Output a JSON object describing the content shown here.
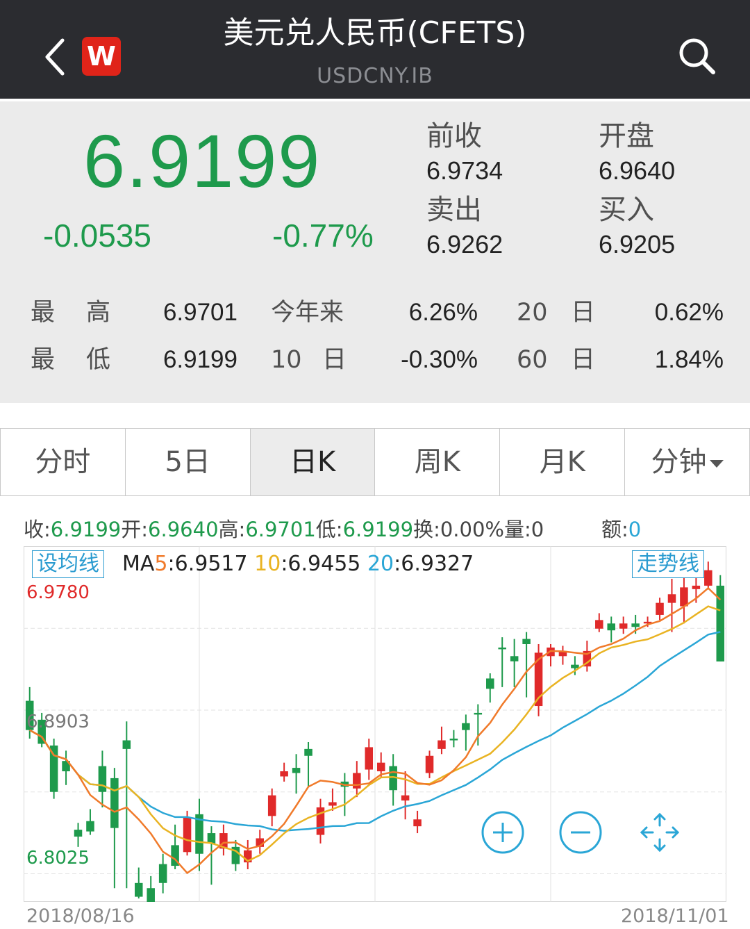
{
  "header": {
    "title": "美元兑人民币(CFETS)",
    "subtitle": "USDCNY.IB",
    "logo_text": "W"
  },
  "quote": {
    "price": "6.9199",
    "change": "-0.0535",
    "change_pct": "-0.77%",
    "prev_close_label": "前收",
    "prev_close": "6.9734",
    "open_label": "开盘",
    "open": "6.9640",
    "sell_label": "卖出",
    "sell": "6.9262",
    "buy_label": "买入",
    "buy": "6.9205",
    "color_down": "#1e9a4c"
  },
  "stats": {
    "high_label1": "最",
    "high_label2": "高",
    "high": "6.9701",
    "low_label1": "最",
    "low_label2": "低",
    "low": "6.9199",
    "ytd_label": "今年来",
    "ytd": "6.26%",
    "d10_num": "10",
    "d10_unit": "日",
    "d10": "-0.30%",
    "d20_num": "20",
    "d20_unit": "日",
    "d20": "0.62%",
    "d60_num": "60",
    "d60_unit": "日",
    "d60": "1.84%"
  },
  "tabs": [
    "分时",
    "5日",
    "日K",
    "周K",
    "月K",
    "分钟"
  ],
  "active_tab": "日K",
  "info": {
    "close_label": "收:",
    "close": "6.9199",
    "open_label": "开:",
    "open": "6.9640",
    "high_label": "高:",
    "high": "6.9701",
    "low_label": "低:",
    "low": "6.9199",
    "turn_label": "换:",
    "turn": "0.00%",
    "vol_label": "量:",
    "vol": "0",
    "amt_label": "额:",
    "amt": "0"
  },
  "ma": {
    "button": "设均线",
    "trend_button": "走势线",
    "ma5_prefix": "MA",
    "ma5_num": "5",
    "ma5": ":6.9517",
    "ma10_num": "10",
    "ma10": ":6.9455",
    "ma20_num": "20",
    "ma20": ":6.9327"
  },
  "chart_data": {
    "type": "candlestick",
    "y_top_label": "6.9780",
    "y_mid_label": "6.8903",
    "y_bottom_label": "6.8025",
    "x_start_label": "2018/08/16",
    "x_end_label": "2018/11/01",
    "ylim": [
      6.78,
      6.987
    ],
    "colors": {
      "up": "#e02a2a",
      "down": "#1e9a4c",
      "ma5": "#f07a2a",
      "ma10": "#e9b322",
      "ma20": "#2aa6d6"
    },
    "candles": [
      {
        "o": 6.897,
        "c": 6.88,
        "h": 6.905,
        "l": 6.875
      },
      {
        "o": 6.886,
        "c": 6.872,
        "h": 6.89,
        "l": 6.87
      },
      {
        "o": 6.871,
        "c": 6.844,
        "h": 6.875,
        "l": 6.84
      },
      {
        "o": 6.862,
        "c": 6.856,
        "h": 6.868,
        "l": 6.848
      },
      {
        "o": 6.822,
        "c": 6.818,
        "h": 6.826,
        "l": 6.812
      },
      {
        "o": 6.827,
        "c": 6.821,
        "h": 6.834,
        "l": 6.819
      },
      {
        "o": 6.859,
        "c": 6.844,
        "h": 6.868,
        "l": 6.835
      },
      {
        "o": 6.852,
        "c": 6.823,
        "h": 6.858,
        "l": 6.788
      },
      {
        "o": 6.874,
        "c": 6.869,
        "h": 6.885,
        "l": 6.788
      },
      {
        "o": 6.791,
        "c": 6.783,
        "h": 6.8,
        "l": 6.782
      },
      {
        "o": 6.788,
        "c": 6.78,
        "h": 6.795,
        "l": 6.778
      },
      {
        "o": 6.802,
        "c": 6.791,
        "h": 6.808,
        "l": 6.785
      },
      {
        "o": 6.813,
        "c": 6.801,
        "h": 6.825,
        "l": 6.799
      },
      {
        "o": 6.809,
        "c": 6.829,
        "h": 6.833,
        "l": 6.807
      },
      {
        "o": 6.831,
        "c": 6.808,
        "h": 6.84,
        "l": 6.798
      },
      {
        "o": 6.82,
        "c": 6.814,
        "h": 6.824,
        "l": 6.79
      },
      {
        "o": 6.811,
        "c": 6.82,
        "h": 6.825,
        "l": 6.807
      },
      {
        "o": 6.812,
        "c": 6.802,
        "h": 6.816,
        "l": 6.798
      },
      {
        "o": 6.803,
        "c": 6.81,
        "h": 6.816,
        "l": 6.799
      },
      {
        "o": 6.812,
        "c": 6.817,
        "h": 6.822,
        "l": 6.808
      },
      {
        "o": 6.83,
        "c": 6.842,
        "h": 6.846,
        "l": 6.824
      },
      {
        "o": 6.853,
        "c": 6.856,
        "h": 6.861,
        "l": 6.85
      },
      {
        "o": 6.858,
        "c": 6.855,
        "h": 6.866,
        "l": 6.843
      },
      {
        "o": 6.869,
        "c": 6.865,
        "h": 6.873,
        "l": 6.847
      },
      {
        "o": 6.819,
        "c": 6.835,
        "h": 6.84,
        "l": 6.814
      },
      {
        "o": 6.836,
        "c": 6.838,
        "h": 6.846,
        "l": 6.833
      },
      {
        "o": 6.85,
        "c": 6.847,
        "h": 6.855,
        "l": 6.83
      },
      {
        "o": 6.846,
        "c": 6.855,
        "h": 6.862,
        "l": 6.841
      },
      {
        "o": 6.857,
        "c": 6.87,
        "h": 6.875,
        "l": 6.851
      },
      {
        "o": 6.856,
        "c": 6.861,
        "h": 6.867,
        "l": 6.852
      },
      {
        "o": 6.859,
        "c": 6.845,
        "h": 6.866,
        "l": 6.836
      },
      {
        "o": 6.839,
        "c": 6.842,
        "h": 6.856,
        "l": 6.828
      },
      {
        "o": 6.824,
        "c": 6.828,
        "h": 6.833,
        "l": 6.82
      },
      {
        "o": 6.855,
        "c": 6.865,
        "h": 6.868,
        "l": 6.852
      },
      {
        "o": 6.869,
        "c": 6.874,
        "h": 6.882,
        "l": 6.866
      },
      {
        "o": 6.875,
        "c": 6.874,
        "h": 6.88,
        "l": 6.87
      },
      {
        "o": 6.884,
        "c": 6.88,
        "h": 6.889,
        "l": 6.868
      },
      {
        "o": 6.89,
        "c": 6.889,
        "h": 6.895,
        "l": 6.871
      },
      {
        "o": 6.91,
        "c": 6.904,
        "h": 6.913,
        "l": 6.896
      },
      {
        "o": 6.928,
        "c": 6.927,
        "h": 6.934,
        "l": 6.905
      },
      {
        "o": 6.923,
        "c": 6.92,
        "h": 6.933,
        "l": 6.905
      },
      {
        "o": 6.933,
        "c": 6.93,
        "h": 6.937,
        "l": 6.899
      },
      {
        "o": 6.894,
        "c": 6.925,
        "h": 6.93,
        "l": 6.888
      },
      {
        "o": 6.923,
        "c": 6.928,
        "h": 6.93,
        "l": 6.917
      },
      {
        "o": 6.923,
        "c": 6.926,
        "h": 6.929,
        "l": 6.918
      },
      {
        "o": 6.918,
        "c": 6.916,
        "h": 6.923,
        "l": 6.912
      },
      {
        "o": 6.917,
        "c": 6.926,
        "h": 6.932,
        "l": 6.914
      },
      {
        "o": 6.939,
        "c": 6.944,
        "h": 6.948,
        "l": 6.937
      },
      {
        "o": 6.942,
        "c": 6.938,
        "h": 6.946,
        "l": 6.931
      },
      {
        "o": 6.939,
        "c": 6.942,
        "h": 6.946,
        "l": 6.936
      },
      {
        "o": 6.942,
        "c": 6.94,
        "h": 6.947,
        "l": 6.936
      },
      {
        "o": 6.942,
        "c": 6.943,
        "h": 6.946,
        "l": 6.94
      },
      {
        "o": 6.947,
        "c": 6.954,
        "h": 6.957,
        "l": 6.944
      },
      {
        "o": 6.954,
        "c": 6.959,
        "h": 6.968,
        "l": 6.937
      },
      {
        "o": 6.952,
        "c": 6.963,
        "h": 6.969,
        "l": 6.942
      },
      {
        "o": 6.962,
        "c": 6.964,
        "h": 6.974,
        "l": 6.954
      },
      {
        "o": 6.964,
        "c": 6.973,
        "h": 6.978,
        "l": 6.962
      },
      {
        "o": 6.964,
        "c": 6.9199,
        "h": 6.9701,
        "l": 6.9199
      }
    ]
  }
}
